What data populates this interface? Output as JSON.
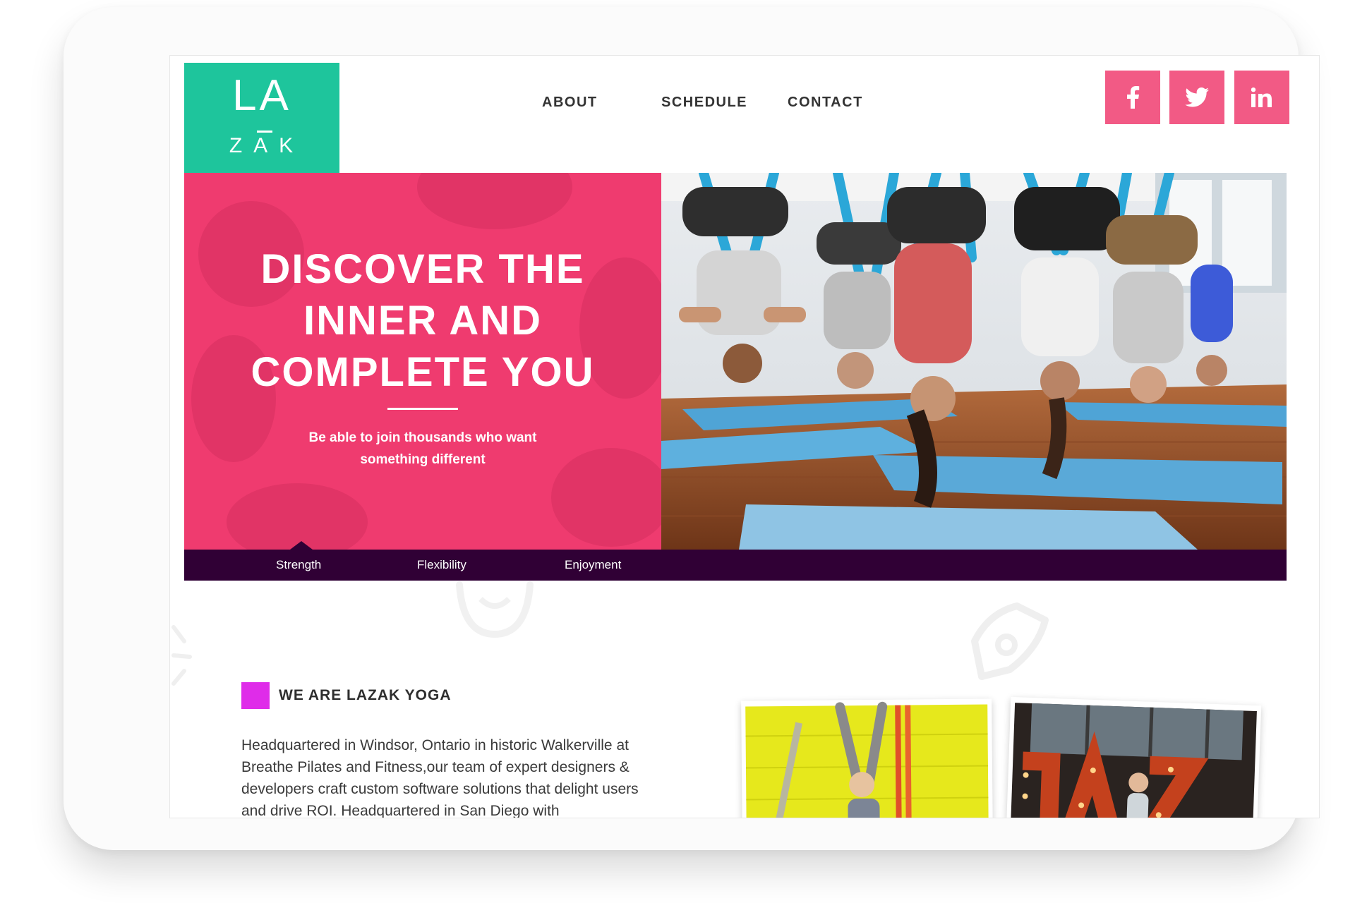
{
  "brand": {
    "logo_top": "LA",
    "logo_bottom": "ZAK",
    "logo_color": "#1ec59c"
  },
  "nav": {
    "about": "ABOUT",
    "schedule": "SCHEDULE",
    "contact": "CONTACT"
  },
  "social": [
    {
      "icon": "facebook-icon"
    },
    {
      "icon": "twitter-icon"
    },
    {
      "icon": "linkedin-icon"
    }
  ],
  "hero": {
    "title_lines": [
      "DISCOVER THE",
      "INNER AND",
      "COMPLETE YOU"
    ],
    "subtitle_lines": [
      "Be able to join thousands who want",
      "something different"
    ],
    "accent_color": "#ef3b6f",
    "photo_icon": "aerial-yoga-class-photo"
  },
  "tabs": {
    "items": [
      "Strength",
      "Flexibility",
      "Enjoyment"
    ],
    "active": "Strength",
    "bar_color": "#300035"
  },
  "about": {
    "heading": "WE ARE LAZAK YOGA",
    "accent_color": "#df2ce9",
    "body": "Headquartered in Windsor, Ontario in historic Walkerville at Breathe Pilates and Fitness,our team of expert designers & developers craft custom software solutions that delight users and drive ROI. Headquartered in San Diego with"
  }
}
